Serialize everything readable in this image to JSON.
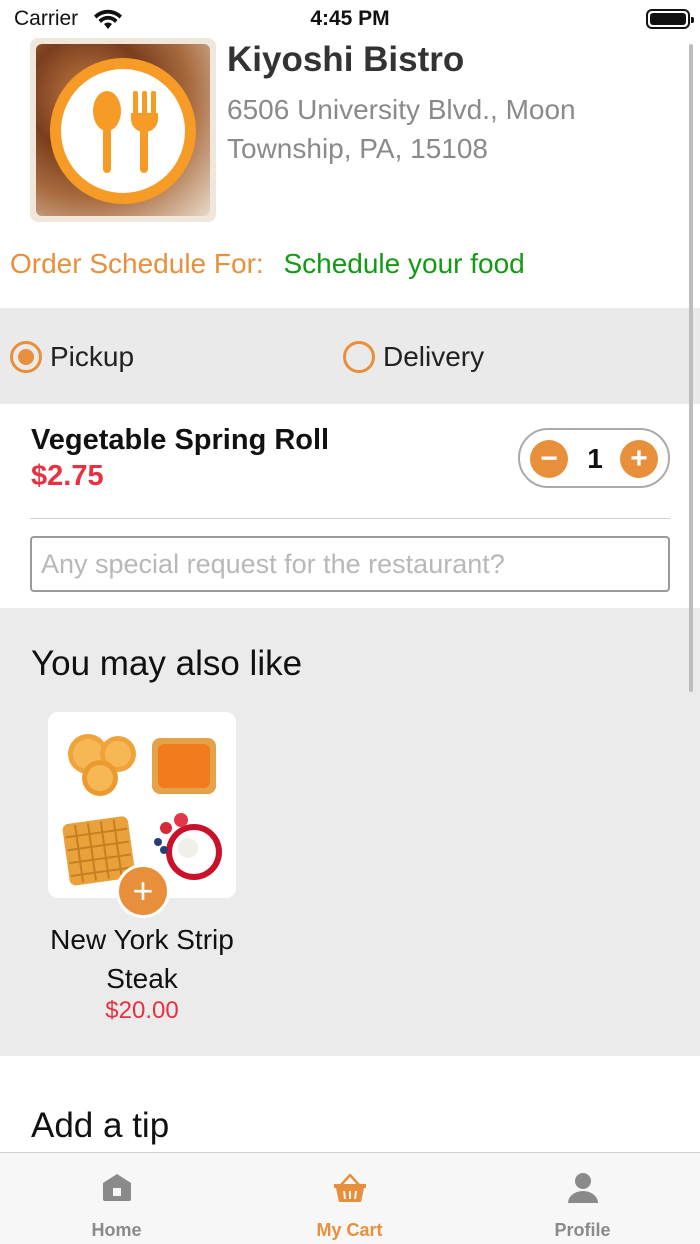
{
  "status_bar": {
    "carrier": "Carrier",
    "time": "4:45 PM"
  },
  "restaurant": {
    "name": "Kiyoshi Bistro",
    "address": "6506 University Blvd., Moon Township, PA, 15108"
  },
  "schedule": {
    "label": "Order Schedule For:",
    "value": "Schedule your food"
  },
  "order_type": {
    "options": [
      {
        "label": "Pickup",
        "selected": true
      },
      {
        "label": "Delivery",
        "selected": false
      }
    ]
  },
  "cart_item": {
    "name": "Vegetable Spring Roll",
    "price": "$2.75",
    "quantity": "1",
    "minus_symbol": "−",
    "plus_symbol": "+",
    "special_request_placeholder": "Any special request for the restaurant?"
  },
  "suggestions": {
    "title": "You may also like",
    "items": [
      {
        "name": "New York Strip Steak",
        "price": "$20.00",
        "add_symbol": "+"
      }
    ]
  },
  "tip": {
    "title": "Add a tip"
  },
  "tab_bar": {
    "tabs": [
      {
        "label": "Home",
        "icon": "home-icon",
        "active": false
      },
      {
        "label": "My Cart",
        "icon": "basket-icon",
        "active": true
      },
      {
        "label": "Profile",
        "icon": "person-icon",
        "active": false
      }
    ]
  },
  "colors": {
    "accent": "#e88f3b",
    "price": "#e83140",
    "schedule_value": "#139a13",
    "section_bg": "#ebebeb"
  }
}
